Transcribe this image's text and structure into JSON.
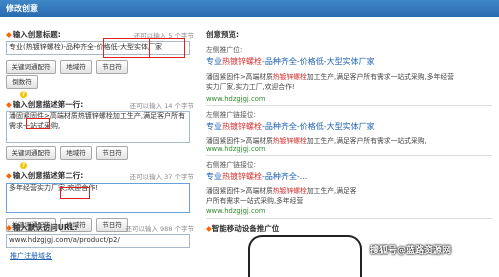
{
  "window": {
    "title": "修改创意"
  },
  "title_section": {
    "label": "输入创意标题:",
    "counter": "还可以输入 5 个字节",
    "value": "专业(热镀锌螺栓)-品种齐全-价格低-大型实体厂家",
    "buttons": [
      "关键词通配符",
      "地域符",
      "节日符",
      "倒数符"
    ]
  },
  "desc1_section": {
    "label": "输入创意描述第一行:",
    "counter": "还可以输入 14 个字节",
    "value": "潘固紧固件>高端材质热镀锌螺栓加工生产,满足客户所有需求一站式采购,",
    "buttons": [
      "关键词通配符",
      "地域符",
      "节日符"
    ]
  },
  "desc2_section": {
    "label": "输入创意描述第二行:",
    "counter": "还可以输入 37 个字节",
    "value": "多年经营实力厂家,欢迎合作!",
    "buttons": [
      "关键词通配符",
      "地域符",
      "节日符"
    ]
  },
  "url_section": {
    "label": "输入默认访问URL:",
    "counter": "还可以输入 988 个字节",
    "value": "www.hdzgjgj.com/a/product/p2/",
    "link": "推广注册域名"
  },
  "preview": {
    "heading": "创意预览:",
    "label_left": "左侧推广位:",
    "label_left2": "左侧推广链接位:",
    "label_right": "右侧推广链接位:",
    "ad1": {
      "title_pre": "专业",
      "title_red": "热镀锌螺栓",
      "title_post": "-品种齐全-价格低-大型实体厂家",
      "desc_pre": "潘固紧固件>高端材质",
      "desc_red": "热镀锌螺栓",
      "desc_post": "加工生产,满足客户所有需求一站式采购,多年经营",
      "desc_line2": "实力厂家,实力工厂,欢迎合作!",
      "url": "www.hdzgjgj.com"
    },
    "ad2": {
      "title_pre": "专业",
      "title_red": "热镀锌螺栓",
      "title_post": "-品种齐全-价格低-大型实体厂家",
      "desc_pre": "潘固紧固件>高端材质",
      "desc_red": "热镀锌螺栓",
      "desc_post": "加工生产,满足客户所有需求一站式采购,",
      "url": "www.hdzgjgj.com"
    },
    "ad3": {
      "title_pre": "专业",
      "title_red": "热镀锌螺栓",
      "title_post": "-品种齐全-...",
      "desc_line1": "潘固紧固件>高端材质",
      "desc_red": "热镀锌螺栓",
      "desc_post": "加工生产,满足客",
      "desc_line2": "户所有需求一站式采购,多年经营",
      "url": "www.hdzgjgj.com"
    },
    "mobile_heading": "智能移动设备推广位"
  },
  "watermark": "搜狐号@蓝路资源网",
  "colors": {
    "titlebar": "#2a6aae",
    "highlight": "#e0201a",
    "keyword": "#d32f2f",
    "link": "#1a5fb4",
    "url": "#2e8b2e"
  }
}
